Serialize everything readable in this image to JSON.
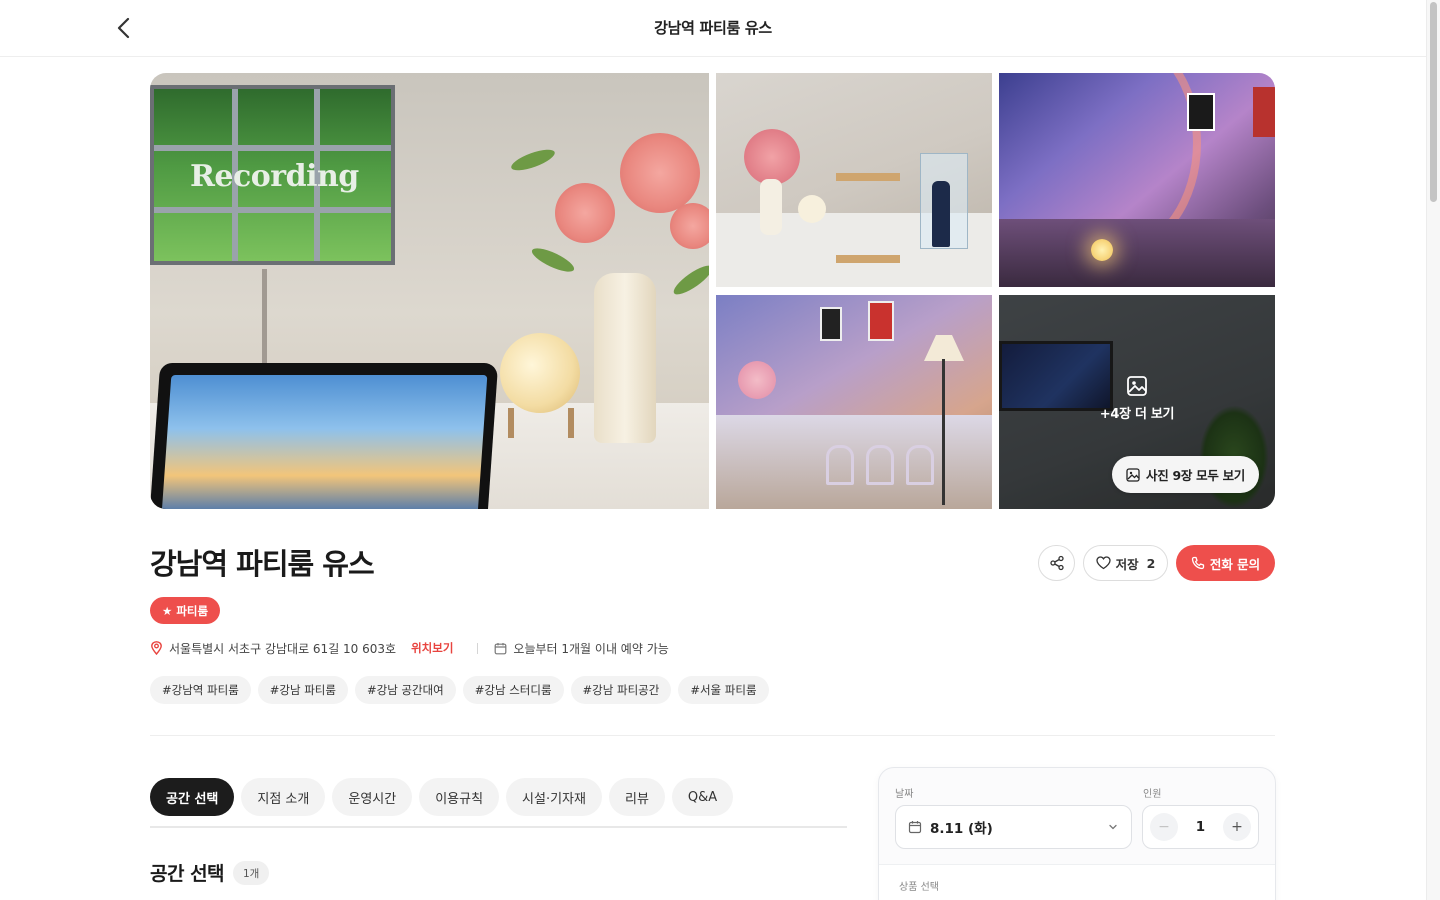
{
  "header": {
    "title": "강남역 파티룸 유스"
  },
  "gallery": {
    "main_overlay_text": "Recording",
    "more_label": "+4장 더 보기",
    "all_photos_label": "사진 9장 모두 보기"
  },
  "place": {
    "title": "강남역 파티룸 유스",
    "category": "파티룸",
    "address": "서울특별시 서초구 강남대로 61길 10 603호",
    "map_link": "위치보기",
    "reservation_note": "오늘부터 1개월 이내 예약 가능",
    "tags": [
      "#강남역 파티룸",
      "#강남 파티룸",
      "#강남 공간대여",
      "#강남 스터디룸",
      "#강남 파티공간",
      "#서울 파티룸"
    ]
  },
  "actions": {
    "save_label": "저장",
    "save_count": "2",
    "call_label": "전화 문의"
  },
  "tabs": [
    {
      "label": "공간 선택",
      "active": true
    },
    {
      "label": "지점 소개"
    },
    {
      "label": "운영시간"
    },
    {
      "label": "이용규칙"
    },
    {
      "label": "시설·기자재"
    },
    {
      "label": "리뷰"
    },
    {
      "label": "Q&A"
    }
  ],
  "section": {
    "title": "공간 선택",
    "count": "1개"
  },
  "booking": {
    "date_label": "날짜",
    "date_value": "8.11 (화)",
    "people_label": "인원",
    "people_value": "1",
    "product_label": "상품 선택"
  },
  "colors": {
    "accent": "#ee4f4c",
    "tab_active": "#1c1c1c"
  }
}
